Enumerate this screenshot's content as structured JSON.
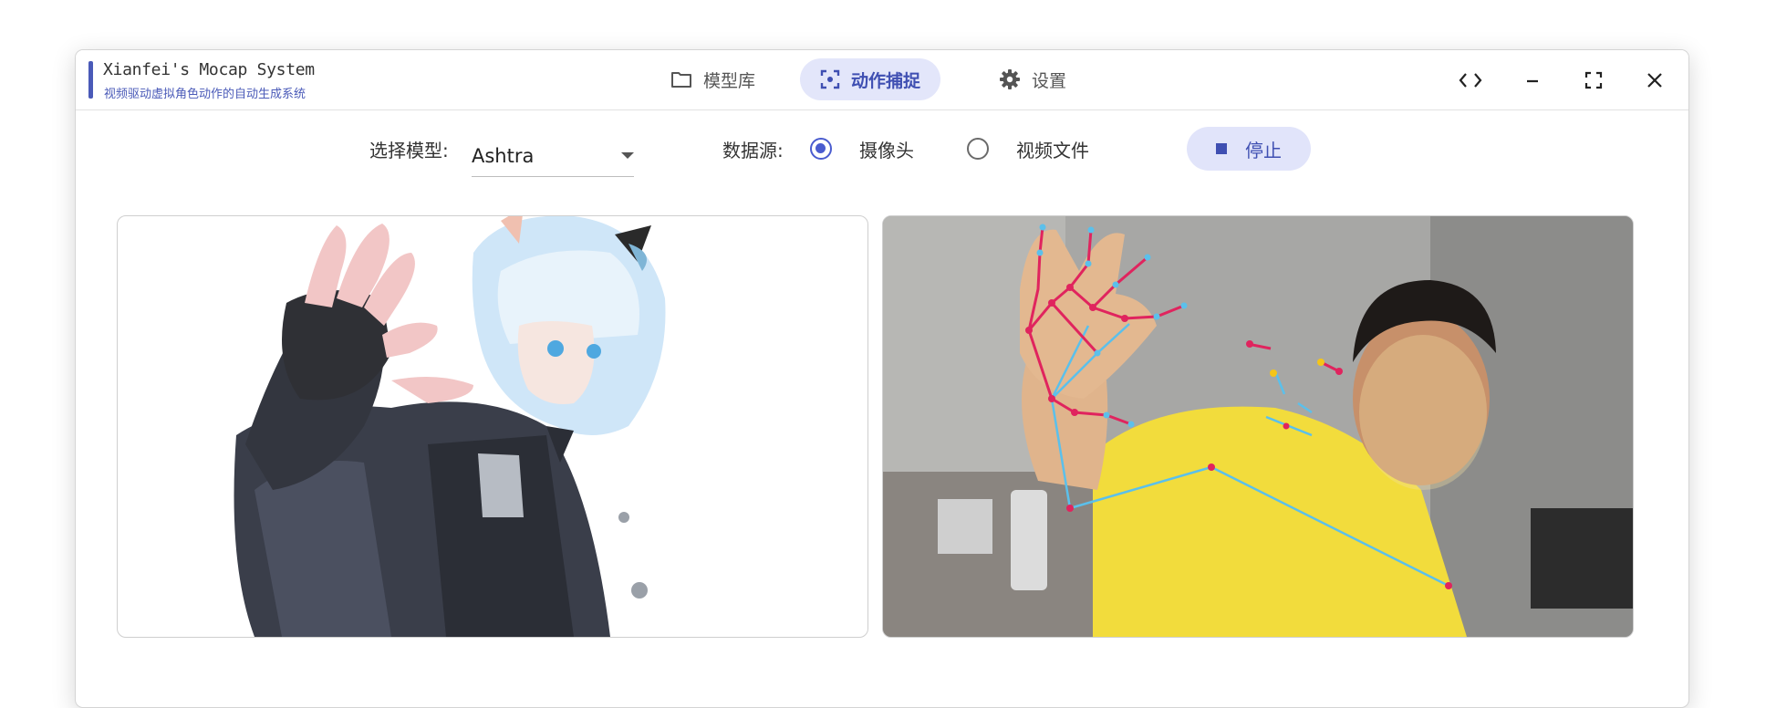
{
  "window": {
    "app_title": "Xianfei's Mocap System",
    "app_subtitle": "视频驱动虚拟角色动作的自动生成系统"
  },
  "nav": {
    "tabs": [
      {
        "label": "模型库",
        "icon": "folder-icon",
        "active": false
      },
      {
        "label": "动作捕捉",
        "icon": "capture-icon",
        "active": true
      },
      {
        "label": "设置",
        "icon": "gear-icon",
        "active": false
      }
    ]
  },
  "window_controls": [
    "code-icon",
    "minimize-icon",
    "fullscreen-icon",
    "close-icon"
  ],
  "toolbar": {
    "model_label": "选择模型:",
    "model_value": "Ashtra",
    "source_label": "数据源:",
    "source_options": [
      {
        "label": "摄像头",
        "selected": true
      },
      {
        "label": "视频文件",
        "selected": false
      }
    ],
    "stop_label": "停止"
  },
  "colors": {
    "accent": "#4a5ccf",
    "active_tab_bg": "#e3e6fa",
    "skeleton_joint": "#e0245e",
    "skeleton_bone": "#5bc0eb",
    "face_mesh": "#f3e0a0"
  },
  "panels": {
    "avatar": "virtual-avatar-render",
    "camera": "camera-feed-with-skeleton"
  }
}
